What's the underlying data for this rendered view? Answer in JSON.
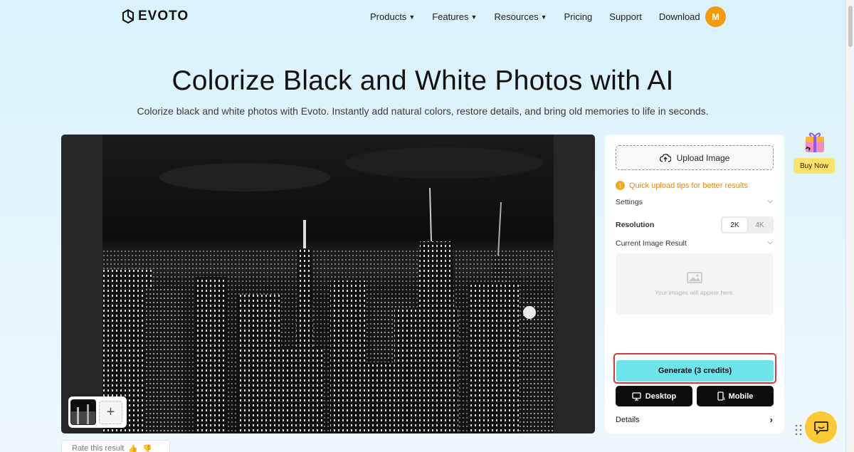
{
  "brand": {
    "name": "EVOTO"
  },
  "nav": {
    "links": [
      {
        "label": "Products",
        "dropdown": true
      },
      {
        "label": "Features",
        "dropdown": true
      },
      {
        "label": "Resources",
        "dropdown": true
      },
      {
        "label": "Pricing",
        "dropdown": false
      },
      {
        "label": "Support",
        "dropdown": false
      },
      {
        "label": "Download",
        "dropdown": false
      }
    ],
    "avatar_initial": "M"
  },
  "hero": {
    "title": "Colorize Black and White Photos with AI",
    "subtitle": "Colorize black and white photos with Evoto. Instantly add natural colors, restore details, and bring old memories to life in seconds."
  },
  "preview": {
    "rate_label": "Rate this result"
  },
  "panel": {
    "upload_label": "Upload Image",
    "tips_label": "Quick upload tips for better results",
    "settings_label": "Settings",
    "resolution_label": "Resolution",
    "resolution_options": [
      "2K",
      "4K"
    ],
    "resolution_selected": "2K",
    "current_result_label": "Current Image Result",
    "result_placeholder": "Your images will appear here.",
    "generate_label": "Generate (3 credits)",
    "desktop_label": "Desktop",
    "mobile_label": "Mobile",
    "details_label": "Details"
  },
  "promo": {
    "buy_now_label": "Buy Now"
  },
  "colors": {
    "accent_orange": "#f59a0a",
    "generate_cyan": "#6ee3ea",
    "highlight_red": "#d9363e",
    "buy_yellow": "#ffe36b",
    "chat_yellow": "#fbc933"
  }
}
